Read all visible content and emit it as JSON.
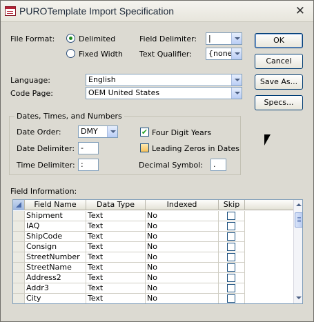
{
  "window": {
    "title": "PUROTemplate Import Specification",
    "close_glyph": "✕"
  },
  "file_format": {
    "label": "File Format:",
    "delimited_label": "Delimited",
    "fixed_width_label": "Fixed Width",
    "selected": "Delimited"
  },
  "field_delimiter": {
    "label": "Field Delimiter:",
    "value": "|"
  },
  "text_qualifier": {
    "label": "Text Qualifier:",
    "value": "{none}"
  },
  "language": {
    "label": "Language:",
    "value": "English"
  },
  "code_page": {
    "label": "Code Page:",
    "value": "OEM United States"
  },
  "buttons": {
    "ok": "OK",
    "cancel": "Cancel",
    "save_as": "Save As...",
    "specs": "Specs..."
  },
  "dates_group": {
    "title": "Dates, Times, and Numbers",
    "date_order_label": "Date Order:",
    "date_order_value": "DMY",
    "date_delimiter_label": "Date Delimiter:",
    "date_delimiter_value": "-",
    "time_delimiter_label": "Time Delimiter:",
    "time_delimiter_value": ":",
    "four_digit_years_label": "Four Digit Years",
    "four_digit_years_checked": true,
    "leading_zeros_label": "Leading Zeros in Dates",
    "leading_zeros_checked": false,
    "decimal_symbol_label": "Decimal Symbol:",
    "decimal_symbol_value": "."
  },
  "field_info": {
    "label": "Field Information:",
    "columns": [
      "Field Name",
      "Data Type",
      "Indexed",
      "Skip"
    ],
    "rows": [
      {
        "name": "Shipment",
        "type": "Text",
        "indexed": "No"
      },
      {
        "name": "IAQ",
        "type": "Text",
        "indexed": "No"
      },
      {
        "name": "ShipCode",
        "type": "Text",
        "indexed": "No"
      },
      {
        "name": "Consign",
        "type": "Text",
        "indexed": "No"
      },
      {
        "name": "StreetNumber",
        "type": "Text",
        "indexed": "No"
      },
      {
        "name": "StreetName",
        "type": "Text",
        "indexed": "No"
      },
      {
        "name": "Address2",
        "type": "Text",
        "indexed": "No"
      },
      {
        "name": "Addr3",
        "type": "Text",
        "indexed": "No"
      },
      {
        "name": "City",
        "type": "Text",
        "indexed": "No"
      }
    ]
  },
  "colors": {
    "dialog_bg": "#dcdad2",
    "accent_green": "#1d8a1d",
    "border_blue": "#7f9db9"
  },
  "icons": {
    "title_icon": "access-table-icon",
    "close_icon": "close-icon"
  }
}
